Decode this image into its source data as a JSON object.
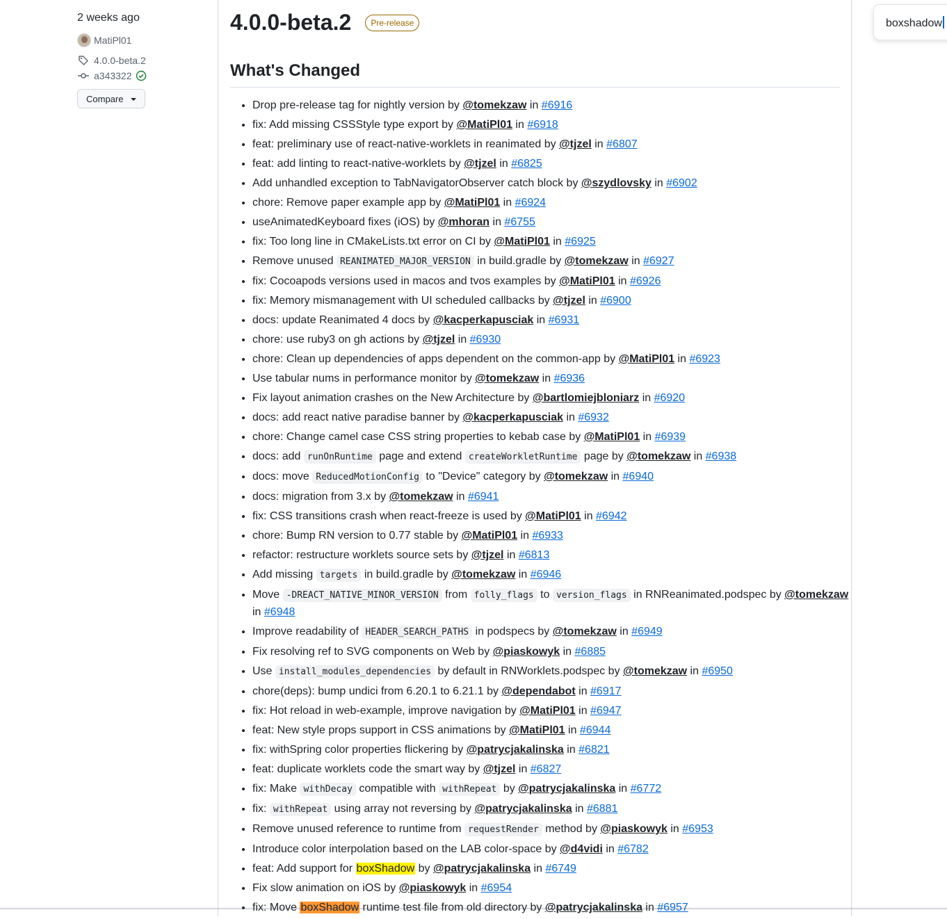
{
  "sidebar": {
    "time_ago": "2 weeks ago",
    "author": "MatiPl01",
    "tag": "4.0.0-beta.2",
    "commit": "a343322",
    "compare_label": "Compare"
  },
  "release": {
    "title": "4.0.0-beta.2",
    "badge": "Pre-release",
    "section_heading": "What's Changed"
  },
  "find_bar": {
    "query": "boxshadow"
  },
  "changes": [
    {
      "p": [
        {
          "t": "t",
          "v": "Drop pre-release tag for nightly version by "
        },
        {
          "t": "u",
          "v": "@tomekzaw"
        },
        {
          "t": "t",
          "v": " in "
        },
        {
          "t": "pr",
          "v": "#6916"
        }
      ]
    },
    {
      "p": [
        {
          "t": "t",
          "v": "fix: Add missing CSSStyle type export by "
        },
        {
          "t": "u",
          "v": "@MatiPl01"
        },
        {
          "t": "t",
          "v": " in "
        },
        {
          "t": "pr",
          "v": "#6918"
        }
      ]
    },
    {
      "p": [
        {
          "t": "t",
          "v": "feat: preliminary use of react-native-worklets in reanimated by "
        },
        {
          "t": "u",
          "v": "@tjzel"
        },
        {
          "t": "t",
          "v": " in "
        },
        {
          "t": "pr",
          "v": "#6807"
        }
      ]
    },
    {
      "p": [
        {
          "t": "t",
          "v": "feat: add linting to react-native-worklets by "
        },
        {
          "t": "u",
          "v": "@tjzel"
        },
        {
          "t": "t",
          "v": " in "
        },
        {
          "t": "pr",
          "v": "#6825"
        }
      ]
    },
    {
      "p": [
        {
          "t": "t",
          "v": "Add unhandled exception to TabNavigatorObserver catch block by "
        },
        {
          "t": "u",
          "v": "@szydlovsky"
        },
        {
          "t": "t",
          "v": " in "
        },
        {
          "t": "pr",
          "v": "#6902"
        }
      ]
    },
    {
      "p": [
        {
          "t": "t",
          "v": "chore: Remove paper example app by "
        },
        {
          "t": "u",
          "v": "@MatiPl01"
        },
        {
          "t": "t",
          "v": " in "
        },
        {
          "t": "pr",
          "v": "#6924"
        }
      ]
    },
    {
      "p": [
        {
          "t": "t",
          "v": "useAnimatedKeyboard fixes (iOS) by "
        },
        {
          "t": "u",
          "v": "@mhoran"
        },
        {
          "t": "t",
          "v": " in "
        },
        {
          "t": "pr",
          "v": "#6755"
        }
      ]
    },
    {
      "p": [
        {
          "t": "t",
          "v": "fix: Too long line in CMakeLists.txt error on CI by "
        },
        {
          "t": "u",
          "v": "@MatiPl01"
        },
        {
          "t": "t",
          "v": " in "
        },
        {
          "t": "pr",
          "v": "#6925"
        }
      ]
    },
    {
      "p": [
        {
          "t": "t",
          "v": "Remove unused "
        },
        {
          "t": "c",
          "v": "REANIMATED_MAJOR_VERSION"
        },
        {
          "t": "t",
          "v": " in build.gradle by "
        },
        {
          "t": "u",
          "v": "@tomekzaw"
        },
        {
          "t": "t",
          "v": " in "
        },
        {
          "t": "pr",
          "v": "#6927"
        }
      ]
    },
    {
      "p": [
        {
          "t": "t",
          "v": "fix: Cocoapods versions used in macos and tvos examples by "
        },
        {
          "t": "u",
          "v": "@MatiPl01"
        },
        {
          "t": "t",
          "v": " in "
        },
        {
          "t": "pr",
          "v": "#6926"
        }
      ]
    },
    {
      "p": [
        {
          "t": "t",
          "v": "fix: Memory mismanagement with UI scheduled callbacks by "
        },
        {
          "t": "u",
          "v": "@tjzel"
        },
        {
          "t": "t",
          "v": " in "
        },
        {
          "t": "pr",
          "v": "#6900"
        }
      ]
    },
    {
      "p": [
        {
          "t": "t",
          "v": "docs: update Reanimated 4 docs by "
        },
        {
          "t": "u",
          "v": "@kacperkapusciak"
        },
        {
          "t": "t",
          "v": " in "
        },
        {
          "t": "pr",
          "v": "#6931"
        }
      ]
    },
    {
      "p": [
        {
          "t": "t",
          "v": "chore: use ruby3 on gh actions by "
        },
        {
          "t": "u",
          "v": "@tjzel"
        },
        {
          "t": "t",
          "v": " in "
        },
        {
          "t": "pr",
          "v": "#6930"
        }
      ]
    },
    {
      "p": [
        {
          "t": "t",
          "v": "chore: Clean up dependencies of apps dependent on the common-app by "
        },
        {
          "t": "u",
          "v": "@MatiPl01"
        },
        {
          "t": "t",
          "v": " in "
        },
        {
          "t": "pr",
          "v": "#6923"
        }
      ]
    },
    {
      "p": [
        {
          "t": "t",
          "v": "Use tabular nums in performance monitor by "
        },
        {
          "t": "u",
          "v": "@tomekzaw"
        },
        {
          "t": "t",
          "v": " in "
        },
        {
          "t": "pr",
          "v": "#6936"
        }
      ]
    },
    {
      "p": [
        {
          "t": "t",
          "v": "Fix layout animation crashes on the New Architecture by "
        },
        {
          "t": "u",
          "v": "@bartlomiejbloniarz"
        },
        {
          "t": "t",
          "v": " in "
        },
        {
          "t": "pr",
          "v": "#6920"
        }
      ]
    },
    {
      "p": [
        {
          "t": "t",
          "v": "docs: add react native paradise banner by "
        },
        {
          "t": "u",
          "v": "@kacperkapusciak"
        },
        {
          "t": "t",
          "v": " in "
        },
        {
          "t": "pr",
          "v": "#6932"
        }
      ]
    },
    {
      "p": [
        {
          "t": "t",
          "v": "chore: Change camel case CSS string properties to kebab case by "
        },
        {
          "t": "u",
          "v": "@MatiPl01"
        },
        {
          "t": "t",
          "v": " in "
        },
        {
          "t": "pr",
          "v": "#6939"
        }
      ]
    },
    {
      "p": [
        {
          "t": "t",
          "v": "docs: add "
        },
        {
          "t": "c",
          "v": "runOnRuntime"
        },
        {
          "t": "t",
          "v": " page and extend "
        },
        {
          "t": "c",
          "v": "createWorkletRuntime"
        },
        {
          "t": "t",
          "v": " page by "
        },
        {
          "t": "u",
          "v": "@tomekzaw"
        },
        {
          "t": "t",
          "v": " in "
        },
        {
          "t": "pr",
          "v": "#6938"
        }
      ]
    },
    {
      "p": [
        {
          "t": "t",
          "v": "docs: move "
        },
        {
          "t": "c",
          "v": "ReducedMotionConfig"
        },
        {
          "t": "t",
          "v": " to \"Device\" category by "
        },
        {
          "t": "u",
          "v": "@tomekzaw"
        },
        {
          "t": "t",
          "v": " in "
        },
        {
          "t": "pr",
          "v": "#6940"
        }
      ]
    },
    {
      "p": [
        {
          "t": "t",
          "v": "docs: migration from 3.x by "
        },
        {
          "t": "u",
          "v": "@tomekzaw"
        },
        {
          "t": "t",
          "v": " in "
        },
        {
          "t": "pr",
          "v": "#6941"
        }
      ]
    },
    {
      "p": [
        {
          "t": "t",
          "v": "fix: CSS transitions crash when react-freeze is used by "
        },
        {
          "t": "u",
          "v": "@MatiPl01"
        },
        {
          "t": "t",
          "v": " in "
        },
        {
          "t": "pr",
          "v": "#6942"
        }
      ]
    },
    {
      "p": [
        {
          "t": "t",
          "v": "chore: Bump RN version to 0.77 stable by "
        },
        {
          "t": "u",
          "v": "@MatiPl01"
        },
        {
          "t": "t",
          "v": " in "
        },
        {
          "t": "pr",
          "v": "#6933"
        }
      ]
    },
    {
      "p": [
        {
          "t": "t",
          "v": "refactor: restructure worklets source sets by "
        },
        {
          "t": "u",
          "v": "@tjzel"
        },
        {
          "t": "t",
          "v": " in "
        },
        {
          "t": "pr",
          "v": "#6813"
        }
      ]
    },
    {
      "p": [
        {
          "t": "t",
          "v": "Add missing "
        },
        {
          "t": "c",
          "v": "targets"
        },
        {
          "t": "t",
          "v": " in build.gradle by "
        },
        {
          "t": "u",
          "v": "@tomekzaw"
        },
        {
          "t": "t",
          "v": " in "
        },
        {
          "t": "pr",
          "v": "#6946"
        }
      ]
    },
    {
      "p": [
        {
          "t": "t",
          "v": "Move "
        },
        {
          "t": "c",
          "v": "-DREACT_NATIVE_MINOR_VERSION"
        },
        {
          "t": "t",
          "v": " from "
        },
        {
          "t": "c",
          "v": "folly_flags"
        },
        {
          "t": "t",
          "v": " to "
        },
        {
          "t": "c",
          "v": "version_flags"
        },
        {
          "t": "t",
          "v": " in RNReanimated.podspec by "
        },
        {
          "t": "u",
          "v": "@tomekzaw"
        },
        {
          "t": "t",
          "v": " in "
        },
        {
          "t": "pr",
          "v": "#6948"
        }
      ]
    },
    {
      "p": [
        {
          "t": "t",
          "v": "Improve readability of "
        },
        {
          "t": "c",
          "v": "HEADER_SEARCH_PATHS"
        },
        {
          "t": "t",
          "v": " in podspecs by "
        },
        {
          "t": "u",
          "v": "@tomekzaw"
        },
        {
          "t": "t",
          "v": " in "
        },
        {
          "t": "pr",
          "v": "#6949"
        }
      ]
    },
    {
      "p": [
        {
          "t": "t",
          "v": "Fix resolving ref to SVG components on Web by "
        },
        {
          "t": "u",
          "v": "@piaskowyk"
        },
        {
          "t": "t",
          "v": " in "
        },
        {
          "t": "pr",
          "v": "#6885"
        }
      ]
    },
    {
      "p": [
        {
          "t": "t",
          "v": "Use "
        },
        {
          "t": "c",
          "v": "install_modules_dependencies"
        },
        {
          "t": "t",
          "v": " by default in RNWorklets.podspec by "
        },
        {
          "t": "u",
          "v": "@tomekzaw"
        },
        {
          "t": "t",
          "v": " in "
        },
        {
          "t": "pr",
          "v": "#6950"
        }
      ]
    },
    {
      "p": [
        {
          "t": "t",
          "v": "chore(deps): bump undici from 6.20.1 to 6.21.1 by "
        },
        {
          "t": "u",
          "v": "@dependabot"
        },
        {
          "t": "t",
          "v": " in "
        },
        {
          "t": "pr",
          "v": "#6917"
        }
      ]
    },
    {
      "p": [
        {
          "t": "t",
          "v": "fix: Hot reload in web-example, improve navigation by "
        },
        {
          "t": "u",
          "v": "@MatiPl01"
        },
        {
          "t": "t",
          "v": " in "
        },
        {
          "t": "pr",
          "v": "#6947"
        }
      ]
    },
    {
      "p": [
        {
          "t": "t",
          "v": "feat: New style props support in CSS animations by "
        },
        {
          "t": "u",
          "v": "@MatiPl01"
        },
        {
          "t": "t",
          "v": " in "
        },
        {
          "t": "pr",
          "v": "#6944"
        }
      ]
    },
    {
      "p": [
        {
          "t": "t",
          "v": "fix: withSpring color properties flickering by "
        },
        {
          "t": "u",
          "v": "@patrycjakalinska"
        },
        {
          "t": "t",
          "v": " in "
        },
        {
          "t": "pr",
          "v": "#6821"
        }
      ]
    },
    {
      "p": [
        {
          "t": "t",
          "v": "feat: duplicate worklets code the smart way by "
        },
        {
          "t": "u",
          "v": "@tjzel"
        },
        {
          "t": "t",
          "v": " in "
        },
        {
          "t": "pr",
          "v": "#6827"
        }
      ]
    },
    {
      "p": [
        {
          "t": "t",
          "v": "fix: Make "
        },
        {
          "t": "c",
          "v": "withDecay"
        },
        {
          "t": "t",
          "v": " compatible with "
        },
        {
          "t": "c",
          "v": "withRepeat"
        },
        {
          "t": "t",
          "v": " by "
        },
        {
          "t": "u",
          "v": "@patrycjakalinska"
        },
        {
          "t": "t",
          "v": " in "
        },
        {
          "t": "pr",
          "v": "#6772"
        }
      ]
    },
    {
      "p": [
        {
          "t": "t",
          "v": "fix: "
        },
        {
          "t": "c",
          "v": "withRepeat"
        },
        {
          "t": "t",
          "v": " using array not reversing by "
        },
        {
          "t": "u",
          "v": "@patrycjakalinska"
        },
        {
          "t": "t",
          "v": " in "
        },
        {
          "t": "pr",
          "v": "#6881"
        }
      ]
    },
    {
      "p": [
        {
          "t": "t",
          "v": "Remove unused reference to runtime from "
        },
        {
          "t": "c",
          "v": "requestRender"
        },
        {
          "t": "t",
          "v": " method by "
        },
        {
          "t": "u",
          "v": "@piaskowyk"
        },
        {
          "t": "t",
          "v": " in "
        },
        {
          "t": "pr",
          "v": "#6953"
        }
      ]
    },
    {
      "p": [
        {
          "t": "t",
          "v": "Introduce color interpolation based on the LAB color-space by "
        },
        {
          "t": "u",
          "v": "@d4vidi"
        },
        {
          "t": "t",
          "v": " in "
        },
        {
          "t": "pr",
          "v": "#6782"
        }
      ]
    },
    {
      "p": [
        {
          "t": "t",
          "v": "feat: Add support for "
        },
        {
          "t": "h",
          "v": "boxShadow"
        },
        {
          "t": "t",
          "v": " by "
        },
        {
          "t": "u",
          "v": "@patrycjakalinska"
        },
        {
          "t": "t",
          "v": " in "
        },
        {
          "t": "pr",
          "v": "#6749"
        }
      ]
    },
    {
      "p": [
        {
          "t": "t",
          "v": "Fix slow animation on iOS by "
        },
        {
          "t": "u",
          "v": "@piaskowyk"
        },
        {
          "t": "t",
          "v": " in "
        },
        {
          "t": "pr",
          "v": "#6954"
        }
      ]
    },
    {
      "p": [
        {
          "t": "t",
          "v": "fix: Move "
        },
        {
          "t": "hc",
          "v": "boxShadow"
        },
        {
          "t": "t",
          "v": " runtime test file from old directory by "
        },
        {
          "t": "u",
          "v": "@patrycjakalinska"
        },
        {
          "t": "t",
          "v": " in "
        },
        {
          "t": "pr",
          "v": "#6957"
        }
      ]
    }
  ]
}
